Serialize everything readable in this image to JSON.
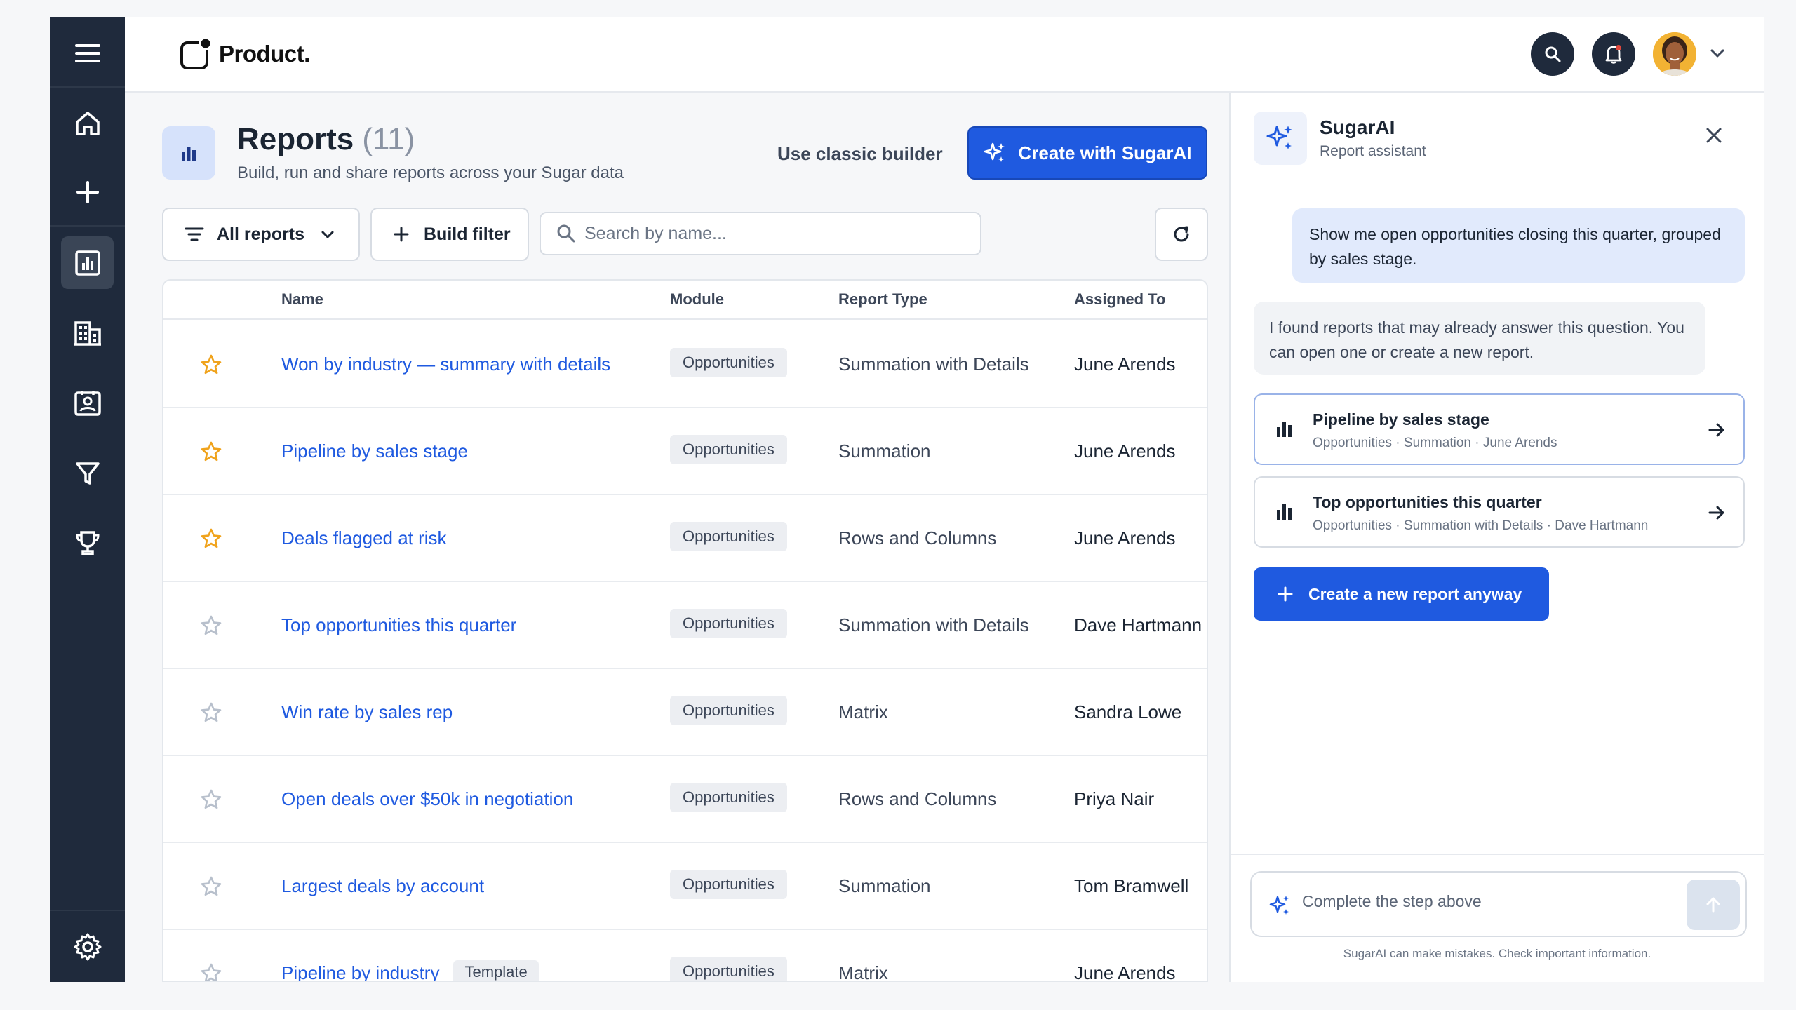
{
  "header": {
    "logo_text": "Product."
  },
  "reports": {
    "title": "Reports",
    "count": "(11)",
    "subtitle": "Build, run and share reports across your Sugar data",
    "classic_builder": "Use classic builder",
    "create_label": "Create with SugarAI",
    "all_reports": "All reports",
    "build_filter": "Build filter",
    "search_placeholder": "Search by name...",
    "columns": [
      "Name",
      "Module",
      "Report Type",
      "Assigned To"
    ],
    "rows": [
      {
        "name": "Won by industry — summary with details",
        "module": "Opportunities",
        "type": "Summation with Details",
        "assigned": "June Arends",
        "starred": true,
        "template": ""
      },
      {
        "name": "Pipeline by sales stage",
        "module": "Opportunities",
        "type": "Summation",
        "assigned": "June Arends",
        "starred": true,
        "template": ""
      },
      {
        "name": "Deals flagged at risk",
        "module": "Opportunities",
        "type": "Rows and Columns",
        "assigned": "June Arends",
        "starred": true,
        "template": ""
      },
      {
        "name": "Top opportunities this quarter",
        "module": "Opportunities",
        "type": "Summation with Details",
        "assigned": "Dave Hartmann",
        "starred": false,
        "template": ""
      },
      {
        "name": "Win rate by sales rep",
        "module": "Opportunities",
        "type": "Matrix",
        "assigned": "Sandra Lowe",
        "starred": false,
        "template": ""
      },
      {
        "name": "Open deals over $50k in negotiation",
        "module": "Opportunities",
        "type": "Rows and Columns",
        "assigned": "Priya Nair",
        "starred": false,
        "template": ""
      },
      {
        "name": "Largest deals by account",
        "module": "Opportunities",
        "type": "Summation",
        "assigned": "Tom Bramwell",
        "starred": false,
        "template": ""
      },
      {
        "name": "Pipeline by industry",
        "module": "Opportunities",
        "type": "Matrix",
        "assigned": "June Arends",
        "starred": false,
        "template": "Template"
      }
    ]
  },
  "ai": {
    "title": "SugarAI",
    "subtitle": "Report assistant",
    "user_message": "Show me open opportunities closing this quarter, grouped by sales stage.",
    "bot_message": "I found reports that may already answer this question. You can open one or create a new report.",
    "suggestions": [
      {
        "title": "Pipeline by sales stage",
        "meta": "Opportunities · Summation · June Arends"
      },
      {
        "title": "Top opportunities this quarter",
        "meta": "Opportunities · Summation with Details · Dave Hartmann"
      }
    ],
    "new_report_label": "Create a new report anyway",
    "composer_placeholder": "Complete the step above",
    "disclaimer": "SugarAI can make mistakes. Check important information."
  },
  "colors": {
    "accent": "#1f5ae0",
    "nav_bg": "#1f2a3c",
    "star_active": "#f0a31c",
    "star_inactive": "#b8c0cc"
  },
  "icons": {
    "nav": [
      "menu-icon",
      "home-icon",
      "plus-icon",
      "reports-icon",
      "building-icon",
      "contact-card-icon",
      "funnel-icon",
      "trophy-icon",
      "gear-icon"
    ],
    "header": [
      "search-icon",
      "bell-icon",
      "chevron-down-icon"
    ]
  }
}
